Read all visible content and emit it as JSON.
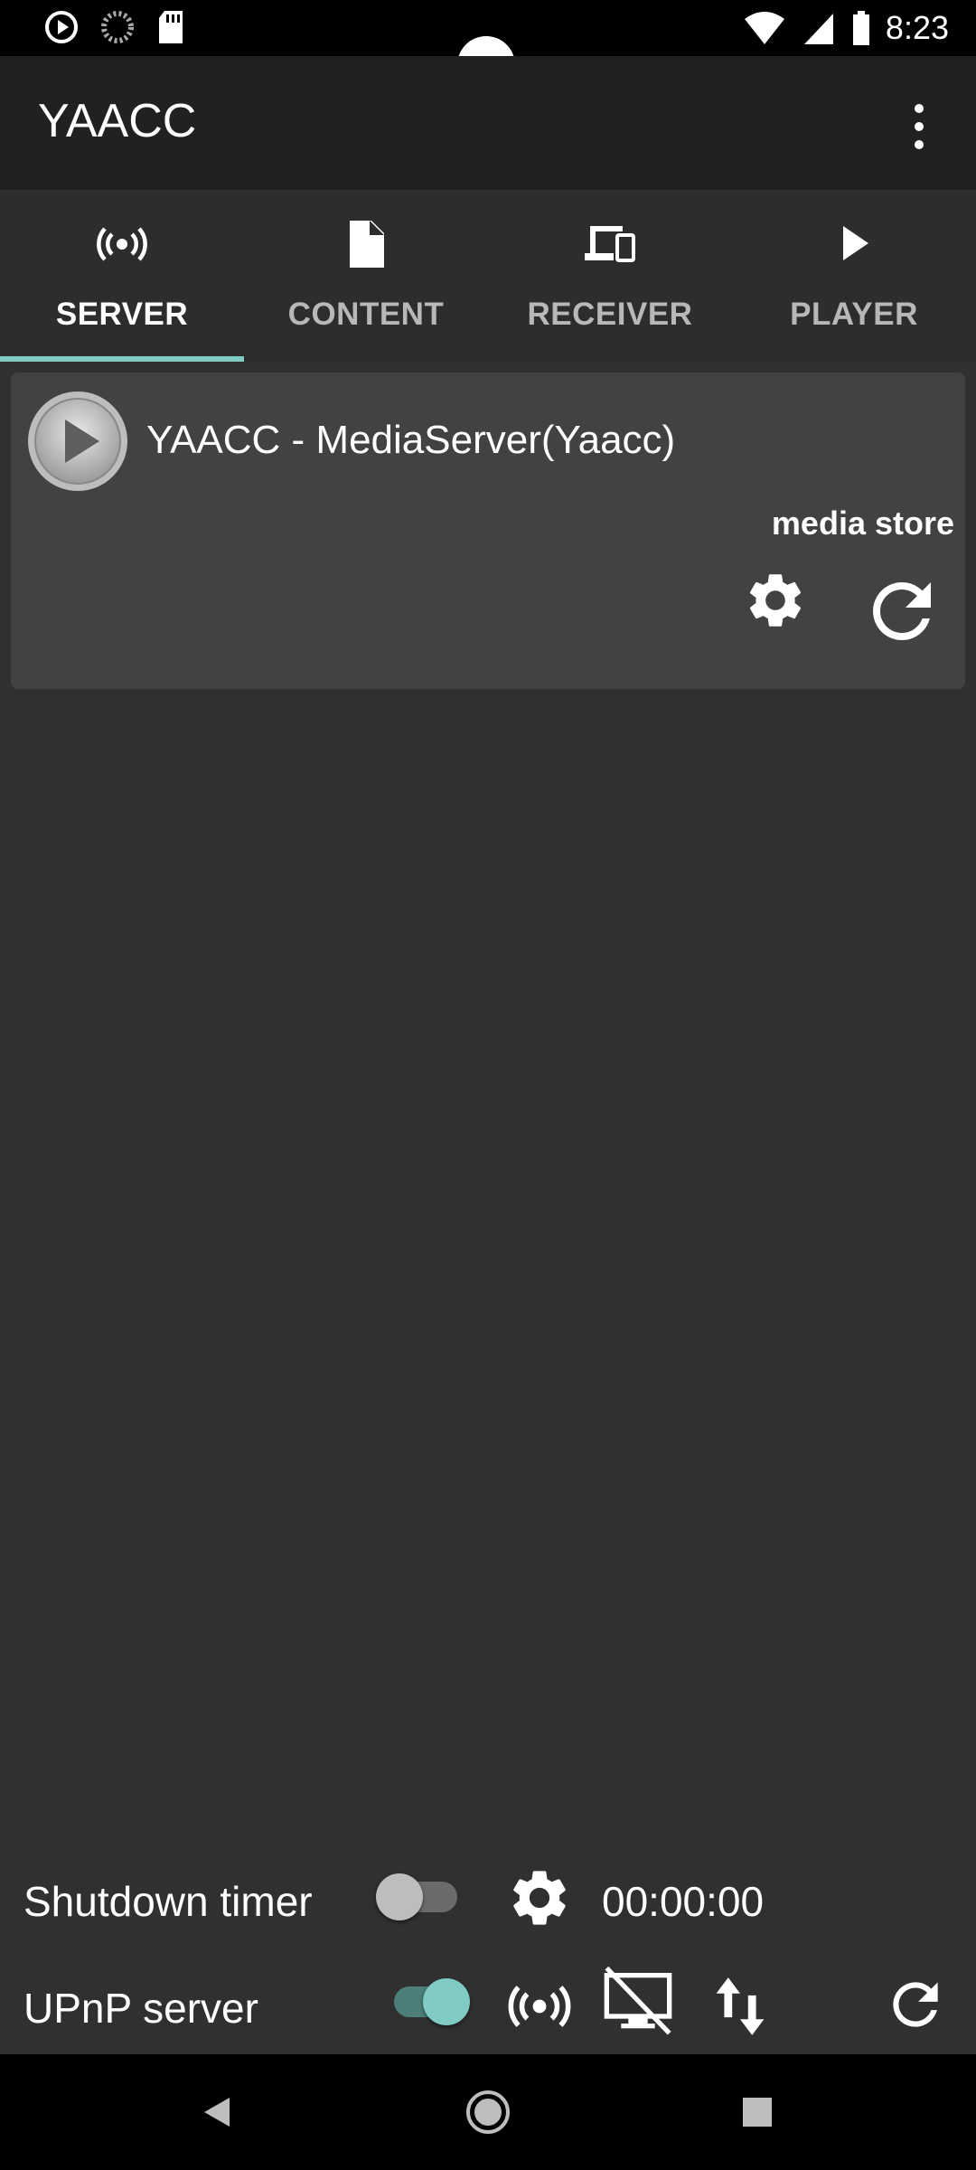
{
  "status_bar": {
    "time": "8:23",
    "left_icons": [
      "media-play-icon",
      "progress-spinner-icon",
      "sd-card-icon"
    ],
    "right_icons": [
      "wifi-icon",
      "cell-signal-icon",
      "battery-icon"
    ]
  },
  "app_bar": {
    "title": "YAACC",
    "overflow_icon": "more-vert-icon"
  },
  "tabs": [
    {
      "label": "SERVER",
      "icon": "broadcast-icon",
      "active": true
    },
    {
      "label": "CONTENT",
      "icon": "document-icon",
      "active": false
    },
    {
      "label": "RECEIVER",
      "icon": "devices-icon",
      "active": false
    },
    {
      "label": "PLAYER",
      "icon": "play-icon",
      "active": false
    }
  ],
  "server_card": {
    "name": "YAACC - MediaServer(Yaacc)",
    "subtitle": "media store",
    "icons": [
      "play-circle-icon",
      "gear-icon",
      "refresh-icon"
    ]
  },
  "controls": {
    "shutdown_timer": {
      "label": "Shutdown timer",
      "enabled": false,
      "time": "00:00:00"
    },
    "upnp_server": {
      "label": "UPnP server",
      "enabled": true
    }
  },
  "colors": {
    "accent": "#80cbc4",
    "background": "#303030",
    "appbar": "#212121",
    "card": "#424242"
  },
  "nav_bar": {
    "icons": [
      "back-icon",
      "home-icon",
      "recents-icon"
    ]
  }
}
